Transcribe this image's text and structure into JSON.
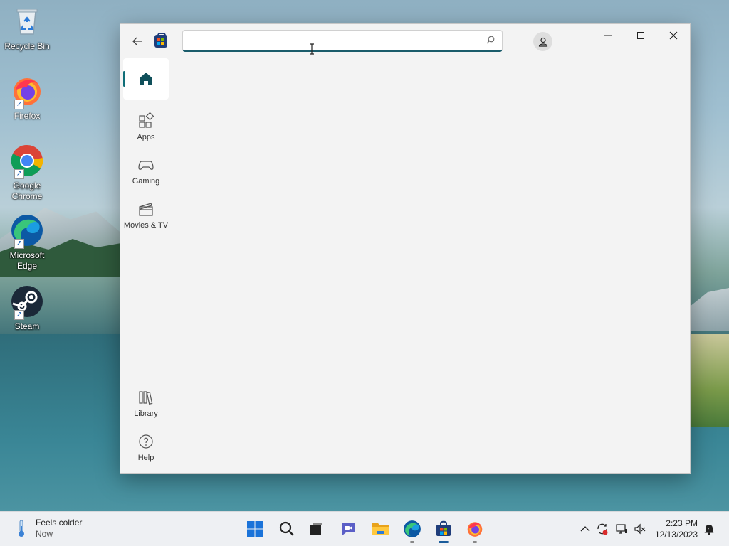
{
  "desktop": {
    "icons": [
      {
        "label": "Recycle Bin"
      },
      {
        "label": "Firefox"
      },
      {
        "label": "Google Chrome"
      },
      {
        "label": "Microsoft Edge"
      },
      {
        "label": "Steam"
      }
    ]
  },
  "store": {
    "search": {
      "value": "",
      "placeholder": ""
    },
    "nav": {
      "home": "",
      "apps": "Apps",
      "gaming": "Gaming",
      "movies": "Movies & TV",
      "library": "Library",
      "help": "Help"
    }
  },
  "taskbar": {
    "weather": {
      "line1": "Feels colder",
      "line2": "Now"
    },
    "apps": [
      "start-icon",
      "search-icon",
      "task-view-icon",
      "chat-icon",
      "file-explorer-icon",
      "edge-icon",
      "store-icon",
      "firefox-icon"
    ],
    "clock": {
      "time": "2:23 PM",
      "date": "12/13/2023"
    }
  },
  "colors": {
    "accent": "#0f6e78",
    "window_bg": "#f3f3f3",
    "taskbar_bg": "#eef0f3"
  }
}
